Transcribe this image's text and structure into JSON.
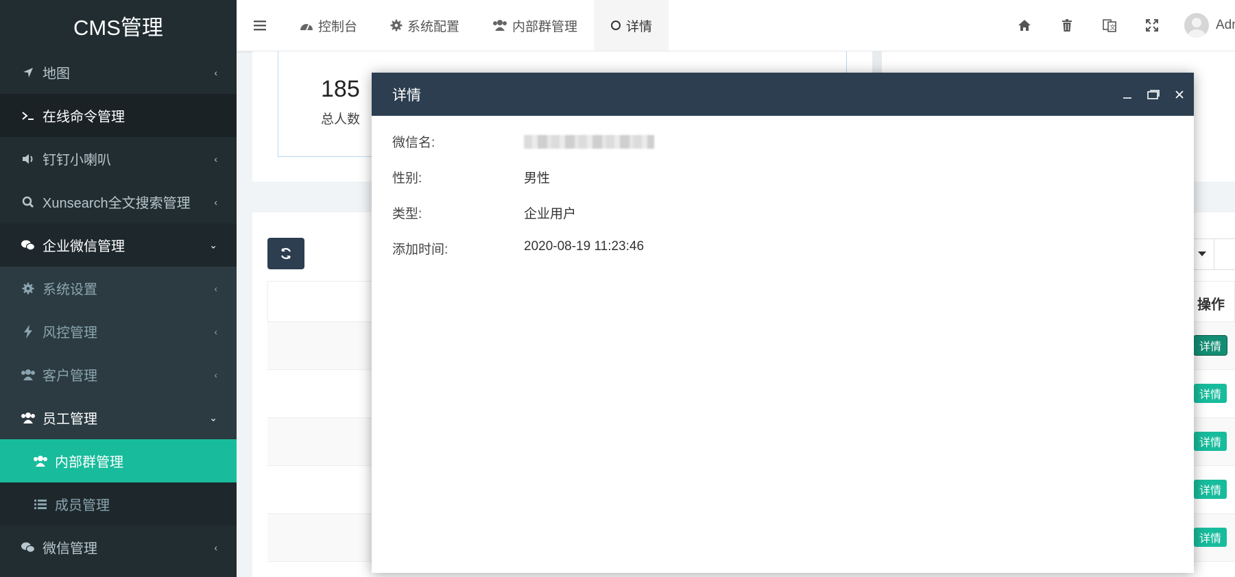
{
  "app": {
    "title": "CMS管理"
  },
  "sidebar": {
    "items": [
      {
        "label": "地图",
        "icon": "location-arrow-icon",
        "caret": "<"
      },
      {
        "label": "在线命令管理",
        "icon": "terminal-icon"
      },
      {
        "label": "钉钉小喇叭",
        "icon": "volume-icon",
        "caret": "<"
      },
      {
        "label": "Xunsearch全文搜索管理",
        "icon": "search-icon",
        "caret": "<"
      },
      {
        "label": "企业微信管理",
        "icon": "wechat-icon",
        "caret": "v"
      },
      {
        "label": "系统设置",
        "icon": "gear-icon",
        "caret": "<"
      },
      {
        "label": "风控管理",
        "icon": "bolt-icon",
        "caret": "<"
      },
      {
        "label": "客户管理",
        "icon": "users-icon",
        "caret": "<"
      },
      {
        "label": "员工管理",
        "icon": "users-icon",
        "caret": "v"
      },
      {
        "label": "内部群管理",
        "icon": "users-icon"
      },
      {
        "label": "成员管理",
        "icon": "list-icon"
      },
      {
        "label": "微信管理",
        "icon": "wechat-icon",
        "caret": "<"
      }
    ]
  },
  "topnav": {
    "tabs": [
      {
        "label": "控制台",
        "icon": "dashboard-icon"
      },
      {
        "label": "系统配置",
        "icon": "gear-icon"
      },
      {
        "label": "内部群管理",
        "icon": "users-icon"
      },
      {
        "label": "详情",
        "icon": "circle-icon"
      }
    ],
    "right_icons": [
      "home-icon",
      "trash-icon",
      "translate-icon",
      "expand-icon"
    ],
    "user_name": "Admin"
  },
  "stats": {
    "total_value": "185",
    "total_label": "总人数"
  },
  "table": {
    "op_header": "操作",
    "row_action_label": "详情",
    "row_count": 5
  },
  "modal": {
    "title": "详情",
    "fields": [
      {
        "label": "微信名:",
        "value": ""
      },
      {
        "label": "性别:",
        "value": "男性"
      },
      {
        "label": "类型:",
        "value": "企业用户"
      },
      {
        "label": "添加时间:",
        "value": "2020-08-19 11:23:46"
      }
    ]
  },
  "colors": {
    "sidebar_bg": "#222d32",
    "accent_green": "#18bc9c",
    "modal_header": "#2c3e50"
  }
}
